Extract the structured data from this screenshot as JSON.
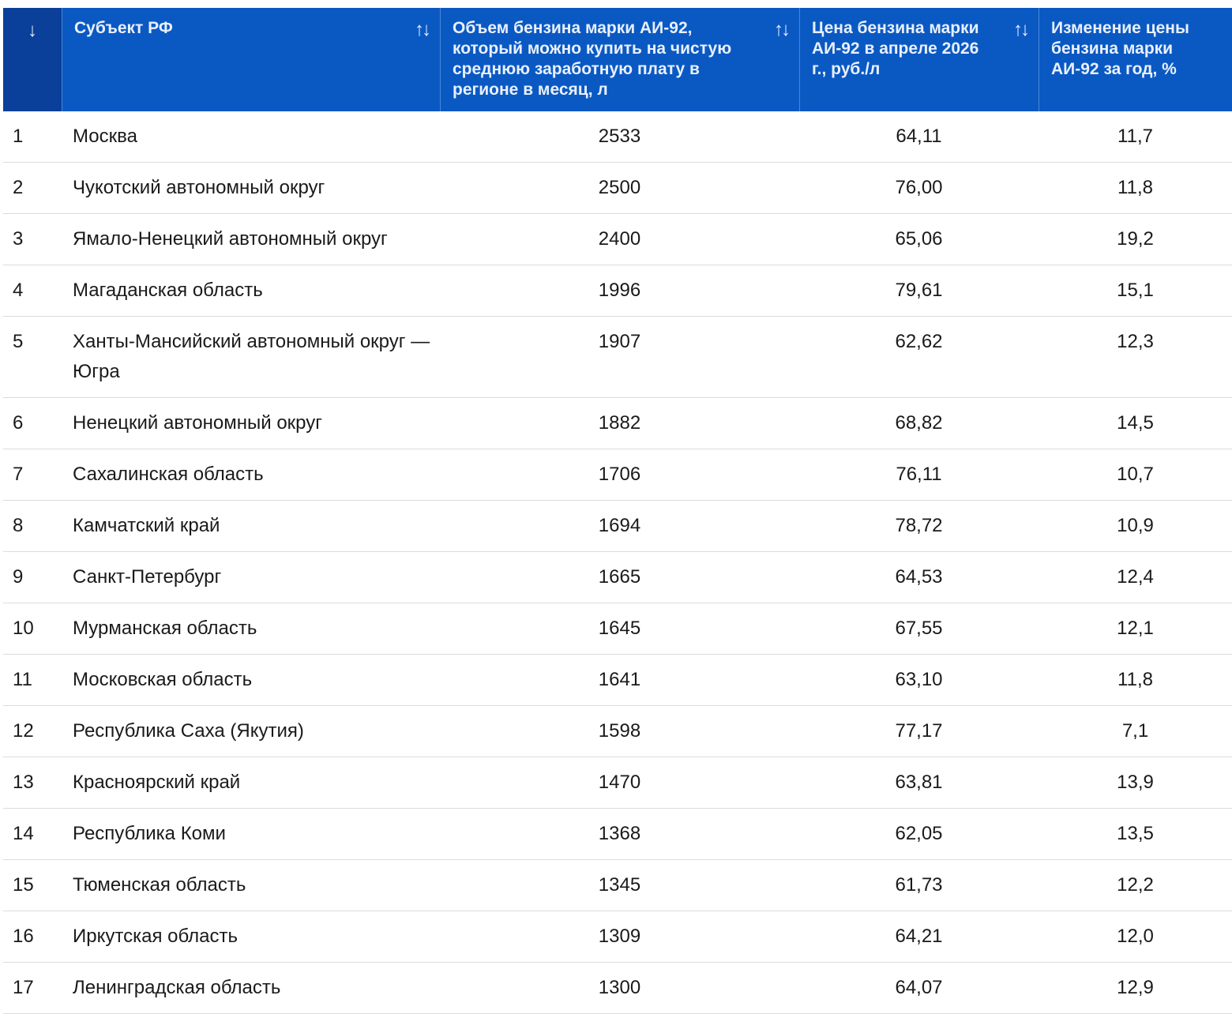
{
  "table": {
    "headers": [
      {
        "label": "",
        "icon": "arrow-down-icon",
        "glyph": "↓"
      },
      {
        "label": "Субъект РФ",
        "icon": "sort-icon",
        "glyph": "↑↓"
      },
      {
        "label": "Объем бензина марки АИ-92, который можно купить на чистую среднюю заработную плату в регионе в месяц, л",
        "icon": "sort-icon",
        "glyph": "↑↓"
      },
      {
        "label": "Цена бензина марки АИ-92 в апреле 2026 г., руб./л",
        "icon": "sort-icon",
        "glyph": "↑↓"
      },
      {
        "label": "Изменение цены бензина марки АИ-92 за год, %"
      }
    ],
    "rows": [
      [
        "1",
        "Москва",
        "2533",
        "64,11",
        "11,7"
      ],
      [
        "2",
        "Чукотский автономный округ",
        "2500",
        "76,00",
        "11,8"
      ],
      [
        "3",
        "Ямало-Ненецкий автономный округ",
        "2400",
        "65,06",
        "19,2"
      ],
      [
        "4",
        "Магаданская область",
        "1996",
        "79,61",
        "15,1"
      ],
      [
        "5",
        "Ханты-Мансийский автономный округ — Югра",
        "1907",
        "62,62",
        "12,3"
      ],
      [
        "6",
        "Ненецкий автономный округ",
        "1882",
        "68,82",
        "14,5"
      ],
      [
        "7",
        "Сахалинская область",
        "1706",
        "76,11",
        "10,7"
      ],
      [
        "8",
        "Камчатский край",
        "1694",
        "78,72",
        "10,9"
      ],
      [
        "9",
        "Санкт-Петербург",
        "1665",
        "64,53",
        "12,4"
      ],
      [
        "10",
        "Мурманская область",
        "1645",
        "67,55",
        "12,1"
      ],
      [
        "11",
        "Московская область",
        "1641",
        "63,10",
        "11,8"
      ],
      [
        "12",
        "Республика Саха (Якутия)",
        "1598",
        "77,17",
        "7,1"
      ],
      [
        "13",
        "Красноярский край",
        "1470",
        "63,81",
        "13,9"
      ],
      [
        "14",
        "Республика Коми",
        "1368",
        "62,05",
        "13,5"
      ],
      [
        "15",
        "Тюменская область",
        "1345",
        "61,73",
        "12,2"
      ],
      [
        "16",
        "Иркутская область",
        "1309",
        "64,21",
        "12,0"
      ],
      [
        "17",
        "Ленинградская область",
        "1300",
        "64,07",
        "12,9"
      ]
    ]
  },
  "colors": {
    "header_bg": "#0a59c3",
    "sorted_header_bg": "#0a3f9a",
    "header_text": "#e9f0fb",
    "row_divider": "#dcdcdc"
  }
}
